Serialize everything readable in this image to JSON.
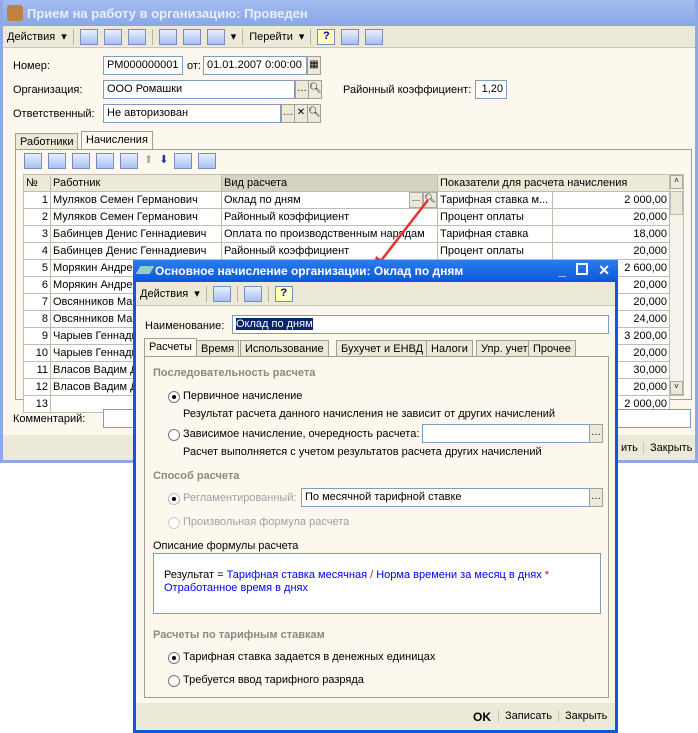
{
  "main": {
    "title": "Прием на работу в организацию: Проведен",
    "toolbar": {
      "actions": "Действия",
      "goto": "Перейти",
      "help": "?"
    },
    "number_label": "Номер:",
    "number": "РМ000000001",
    "from_label": "от:",
    "date": "01.01.2007  0:00:00",
    "org_label": "Организация:",
    "org": "ООО Ромашки",
    "coef_label": "Районный коэффициент:",
    "coef": "1,20",
    "resp_label": "Ответственный:",
    "resp": "Не авторизован",
    "tabs": [
      {
        "label": "Работники"
      },
      {
        "label": "Начисления"
      }
    ],
    "table": {
      "headers": [
        "№",
        "Работник",
        "Вид расчета",
        "Показатели для расчета начисления"
      ],
      "rows": [
        [
          "1",
          "Муляков Семен Германович",
          "Оклад по дням",
          "Тарифная ставка м...",
          "2 000,00"
        ],
        [
          "2",
          "Муляков Семен Германович",
          "Районный коэффициент",
          "Процент оплаты",
          "20,000"
        ],
        [
          "3",
          "Бабинцев Денис Геннадиевич",
          "Оплата по производственным нарядам",
          "Тарифная ставка",
          "18,000"
        ],
        [
          "4",
          "Бабинцев Денис Геннадиевич",
          "Районный коэффициент",
          "Процент оплаты",
          "20,000"
        ],
        [
          "5",
          "Морякин Андрей",
          "",
          "",
          "2 600,00"
        ],
        [
          "6",
          "Морякин Андрей",
          "",
          "",
          "20,000"
        ],
        [
          "7",
          "Овсянников Ма",
          "",
          "",
          "20,000"
        ],
        [
          "8",
          "Овсянников Ма",
          "",
          "",
          "24,000"
        ],
        [
          "9",
          "Чарыев Геннади",
          "",
          "",
          "3 200,00"
        ],
        [
          "10",
          "Чарыев Геннади",
          "",
          "",
          "20,000"
        ],
        [
          "11",
          "Власов Вадим Д",
          "",
          "",
          "30,000"
        ],
        [
          "12",
          "Власов Вадим Д",
          "",
          "",
          "20,000"
        ],
        [
          "13",
          "",
          "",
          "",
          "2 000,00"
        ]
      ]
    },
    "comment_label": "Комментарий:",
    "buttons": {
      "save_partial": "ить",
      "close": "Закрыть"
    }
  },
  "dialog": {
    "title": "Основное начисление организации: Оклад по дням",
    "toolbar": {
      "actions": "Действия",
      "help": "?"
    },
    "name_label": "Наименование:",
    "name": "Оклад по дням",
    "tabs": [
      {
        "label": "Расчеты"
      },
      {
        "label": "Время"
      },
      {
        "label": "Использование"
      },
      {
        "label": "Бухучет и ЕНВД"
      },
      {
        "label": "Налоги"
      },
      {
        "label": "Упр. учет"
      },
      {
        "label": "Прочее"
      }
    ],
    "seq_title": "Последовательность расчета",
    "primary": "Первичное начисление",
    "primary_desc": "Результат расчета данного начисления не зависит от других начислений",
    "dependent": "Зависимое начисление, очередность расчета:",
    "dependent_desc": "Расчет выполняется с учетом результатов расчета других начислений",
    "method_title": "Способ расчета",
    "regulated": "Регламентированный:",
    "regulated_value": "По месячной тарифной ставке",
    "custom": "Произвольная формула расчета",
    "formula_title": "Описание формулы расчета",
    "formula": {
      "result": "Результат = ",
      "p1": "Тарифная ставка месячная",
      "op1": " / ",
      "p2": "Норма времени за месяц в днях",
      "op2": " *",
      "p3": "Отработанное время в днях"
    },
    "tariff_title": "Расчеты по тарифным ставкам",
    "tariff_money": "Тарифная ставка задается в денежных единицах",
    "tariff_grade": "Требуется ввод тарифного разряда",
    "buttons": {
      "ok": "OK",
      "save": "Записать",
      "close": "Закрыть"
    }
  },
  "colors": {
    "formula_blue": "#0000ff",
    "formula_red": "#ff0000",
    "arrow": "#e83030",
    "selection": "#0a246a"
  }
}
